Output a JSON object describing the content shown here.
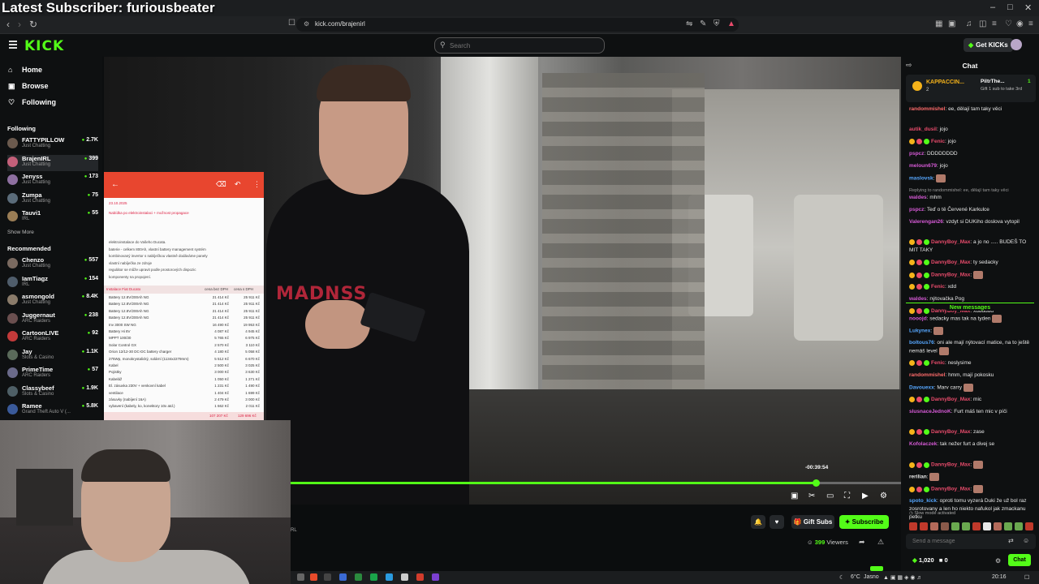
{
  "overlay": {
    "title": "Latest Subscriber: furiousbeater"
  },
  "browser": {
    "url": "kick.com/brajenirl"
  },
  "header": {
    "logo": "KICK",
    "search_placeholder": "Search",
    "get_kicks": "Get KICKs"
  },
  "sidebar": {
    "nav": [
      {
        "label": "Home",
        "icon": "home-icon"
      },
      {
        "label": "Browse",
        "icon": "browse-icon"
      },
      {
        "label": "Following",
        "icon": "heart-icon"
      }
    ],
    "following_title": "Following",
    "following": [
      {
        "name": "FATTYPILLOW",
        "category": "Just Chatting",
        "viewers": "2.7K",
        "color": "#6b5a4e"
      },
      {
        "name": "BrajenIRL",
        "category": "Just Chatting",
        "viewers": "399",
        "color": "#c4607a"
      },
      {
        "name": "Jenyss",
        "category": "Just Chatting",
        "viewers": "173",
        "color": "#8e6fa0"
      },
      {
        "name": "Zumpa",
        "category": "Just Chatting",
        "viewers": "75",
        "color": "#5b6c7a"
      },
      {
        "name": "Tauvi1",
        "category": "IRL",
        "viewers": "55",
        "color": "#9a7d55"
      }
    ],
    "show_more": "Show More",
    "recommended_title": "Recommended",
    "recommended": [
      {
        "name": "Chenzo",
        "category": "Just Chatting",
        "viewers": "557",
        "color": "#7a6a60"
      },
      {
        "name": "IamTiagz",
        "category": "IRL",
        "viewers": "154",
        "color": "#4f5d6b"
      },
      {
        "name": "asmongold",
        "category": "Just Chatting",
        "viewers": "8.4K",
        "color": "#8a7b6a"
      },
      {
        "name": "Juggernaut",
        "category": "ARC Raiders",
        "viewers": "238",
        "color": "#6a4f4f"
      },
      {
        "name": "CartoonLIVE",
        "category": "ARC Raiders",
        "viewers": "92",
        "color": "#c23a3a"
      },
      {
        "name": "Jay",
        "category": "Slots & Casino",
        "viewers": "1.1K",
        "color": "#5a6a5a"
      },
      {
        "name": "PrimeTime",
        "category": "ARC Raiders",
        "viewers": "57",
        "color": "#6a6a8a"
      },
      {
        "name": "Classybeef",
        "category": "Slots & Casino",
        "viewers": "1.9K",
        "color": "#4e5f66"
      },
      {
        "name": "Ramee",
        "category": "Grand Theft Auto V (...",
        "viewers": "5.8K",
        "color": "#3a5a9a"
      }
    ]
  },
  "video": {
    "shirt_text": "MADNSS",
    "time_tip": "-00:39:54",
    "progress": 0.86
  },
  "doc": {
    "date": "23.10.2025",
    "subject": "Nabídka po elektroinstalaci + možnost propagace",
    "lines": [
      "elektroinstalace do Vašeho Ducata.",
      "baterie - celkem 800Ah, vlastní battery management systém",
      "kombinovaný invertor s nabíječkou vlastně dodáváme panely",
      "vlastní nabíječka ze zdroje",
      "regulátor se může upravit podle prostorových dispozic",
      "komponenty na propojení."
    ],
    "table_header": [
      "Instalace Fiat Ducato",
      "cena bez DPH",
      "cena s DPH"
    ],
    "rows": [
      [
        "Battery 12.8V/200Ah NG",
        "21 414 Kč",
        "25 911 Kč"
      ],
      [
        "Battery 12.8V/200Ah NG",
        "21 414 Kč",
        "25 911 Kč"
      ],
      [
        "Battery 12.8V/200Ah NG",
        "21 414 Kč",
        "25 911 Kč"
      ],
      [
        "Battery 12.8V/200Ah NG",
        "21 414 Kč",
        "25 911 Kč"
      ],
      [
        "Inv 3000 SW NG",
        "16 490 Kč",
        "19 953 Kč"
      ],
      [
        "Battery Hi 8V",
        "4 087 Kč",
        "4 945 Kč"
      ],
      [
        "MPPT 100/30",
        "5 765 Kč",
        "6 975 Kč"
      ],
      [
        "Solar Control GX",
        "2 570 Kč",
        "3 110 Kč"
      ],
      [
        "Orion 12/12-30 DC-DC battery charger",
        "4 180 Kč",
        "5 058 Kč"
      ],
      [
        "275Wp, monokrystalický, solární (1134x2279mm)",
        "5 512 Kč",
        "6 670 Kč"
      ],
      [
        "Kabel",
        "2 500 Kč",
        "3 025 Kč"
      ],
      [
        "Pojistky",
        "3 000 Kč",
        "3 630 Kč"
      ],
      [
        "Kabeláž",
        "1 050 Kč",
        "1 271 Kč"
      ],
      [
        "El. zásuvka 230V + venkovní kabel",
        "1 231 Kč",
        "1 490 Kč"
      ],
      [
        "ventilace",
        "1 404 Kč",
        "1 699 Kč"
      ],
      [
        "zásuvky (nabíjení 16A)",
        "2 479 Kč",
        "3 000 Kč"
      ],
      [
        "vybavení (kabely, ko, konektory 10x atd.)",
        "1 662 Kč",
        "2 011 Kč"
      ]
    ],
    "total": [
      "107 207 Kč",
      "129 696 Kč"
    ]
  },
  "below": {
    "gift_subs": "Gift Subs",
    "subscribe": "Subscribe",
    "viewers_count": "399",
    "viewers_label": "Viewers",
    "partial_label": "RL"
  },
  "taskbar": {
    "temp": "6°C",
    "weather": "Jasno",
    "time": "20:16"
  },
  "chat": {
    "title": "Chat",
    "pinned": {
      "name": "KAPPACCIN...",
      "count": "2",
      "right_name": "PiltrThe...",
      "right_count": "1",
      "right_text": "Gift 1 sub to take 3rd"
    },
    "messages": [
      {
        "user": "randommishel",
        "color": "#ff6b6b",
        "text": "ee, dělají tam taky věci"
      },
      {
        "user": "autik_dusil",
        "color": "#e84b6b",
        "text": "jojo"
      },
      {
        "user": "Fenic",
        "color": "#e84b6b",
        "text": "jojo",
        "badges": true
      },
      {
        "user": "pspcz",
        "color": "#d65ad6",
        "text": "DDDDDDDD"
      },
      {
        "user": "meloun679",
        "color": "#d65ad6",
        "text": "jojo"
      },
      {
        "user": "maslovsk",
        "color": "#56a7ff",
        "text": "",
        "emote": true
      },
      {
        "reply": "Replying to randommishel: ee, dělají tam taky věci"
      },
      {
        "user": "waldes",
        "color": "#d65ad6",
        "text": "mhm"
      },
      {
        "user": "pspcz",
        "color": "#d65ad6",
        "text": "Teď o tě Červené Karkulce"
      },
      {
        "user": "Valerengan26",
        "color": "#d65ad6",
        "text": "vzdyt si DUKiho doslova vytopil"
      },
      {
        "user": "DannyBoy_Max",
        "color": "#e84b6b",
        "text": "a jo no ..... BUDEŠ TO MIT TAKY",
        "badges": true
      },
      {
        "user": "DannyBoy_Max",
        "color": "#e84b6b",
        "text": "ty sedacky",
        "badges": true
      },
      {
        "user": "DannyBoy_Max",
        "color": "#e84b6b",
        "text": "",
        "emote": true,
        "badges": true
      },
      {
        "user": "Fenic",
        "color": "#e84b6b",
        "text": "xdd",
        "badges": true
      },
      {
        "user": "waldes",
        "color": "#d65ad6",
        "text": "nýtovačka Pog"
      },
      {
        "user": "DannyBoy_Max",
        "color": "#e84b6b",
        "text": "xdddddd",
        "badges": true
      }
    ],
    "new_messages": "New messages",
    "messages2": [
      {
        "user": "nooojd",
        "color": "#d65ad6",
        "text": "sedacky mas tak na tyden",
        "emote": true
      },
      {
        "user": "Lukynex",
        "color": "#56a7ff",
        "text": "",
        "emote": true
      },
      {
        "user": "boltous76",
        "color": "#56a7ff",
        "text": "oni ale mají nýtovací matice, na to ještě nemáš level",
        "emote": true
      },
      {
        "user": "Fenic",
        "color": "#e84b6b",
        "text": "neslysime",
        "badges": true
      },
      {
        "user": "randommishel",
        "color": "#ff6b6b",
        "text": "hmm, mají pokosku"
      },
      {
        "user": "Davouexx",
        "color": "#56a7ff",
        "text": "Marv carry",
        "emote": true
      },
      {
        "user": "DannyBoy_Max",
        "color": "#e84b6b",
        "text": "mic",
        "badges": true
      },
      {
        "user": "slusnaceJednoK",
        "color": "#d65ad6",
        "text": "Furt máš ten mic v píči"
      },
      {
        "user": "DannyBoy_Max",
        "color": "#e84b6b",
        "text": "zase",
        "badges": true
      },
      {
        "user": "Kofolaczek",
        "color": "#d65ad6",
        "text": "tak nežer furt a divej se"
      },
      {
        "user": "DannyBoy_Max",
        "color": "#e84b6b",
        "text": "",
        "emote": true,
        "badges": true
      },
      {
        "user": "rerilian",
        "color": "#e8e8e8",
        "text": "",
        "emote": true
      },
      {
        "user": "DannyBoy_Max",
        "color": "#e84b6b",
        "text": "",
        "emote": true,
        "badges": true
      },
      {
        "user": "spoto_kick",
        "color": "#56a7ff",
        "text": "oproti tomu vyzerá Duki že už bol raz zosrotovany a len ho niekto nafukol jak zmackanu petku"
      }
    ],
    "slow_mode": "Slow mode activated",
    "input_placeholder": "Send a message",
    "kicks_count": "1,020",
    "zero_count": "0",
    "send_label": "Chat"
  }
}
